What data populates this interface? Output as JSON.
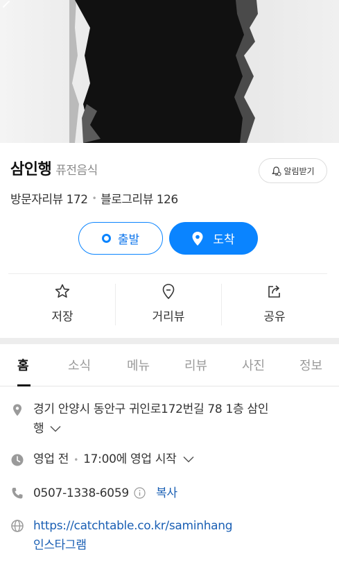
{
  "hero": {
    "back_icon": "chevron-left-icon"
  },
  "place": {
    "name": "삼인행",
    "category": "퓨전음식",
    "alarm_label": "알림받기",
    "visitor_review": "방문자리뷰 172",
    "blog_review": "블로그리뷰 126"
  },
  "route": {
    "start_label": "출발",
    "end_label": "도착"
  },
  "actions": [
    {
      "label": "저장",
      "icon": "star-icon"
    },
    {
      "label": "거리뷰",
      "icon": "location-pin-icon"
    },
    {
      "label": "공유",
      "icon": "share-icon"
    }
  ],
  "tabs": [
    "홈",
    "소식",
    "메뉴",
    "리뷰",
    "사진",
    "정보"
  ],
  "active_tab": "홈",
  "info": {
    "address_line1": "경기 안양시 동안구 귀인로172번길 78 1층 삼인",
    "address_line2": "행",
    "hours_status": "영업 전",
    "hours_detail": "17:00에 영업 시작",
    "phone": "0507-1338-6059",
    "copy_label": "복사",
    "website": "https://catchtable.co.kr/saminhang",
    "instagram": "인스타그램"
  },
  "colors": {
    "accent": "#0a84ff",
    "link": "#1a5fb4"
  }
}
